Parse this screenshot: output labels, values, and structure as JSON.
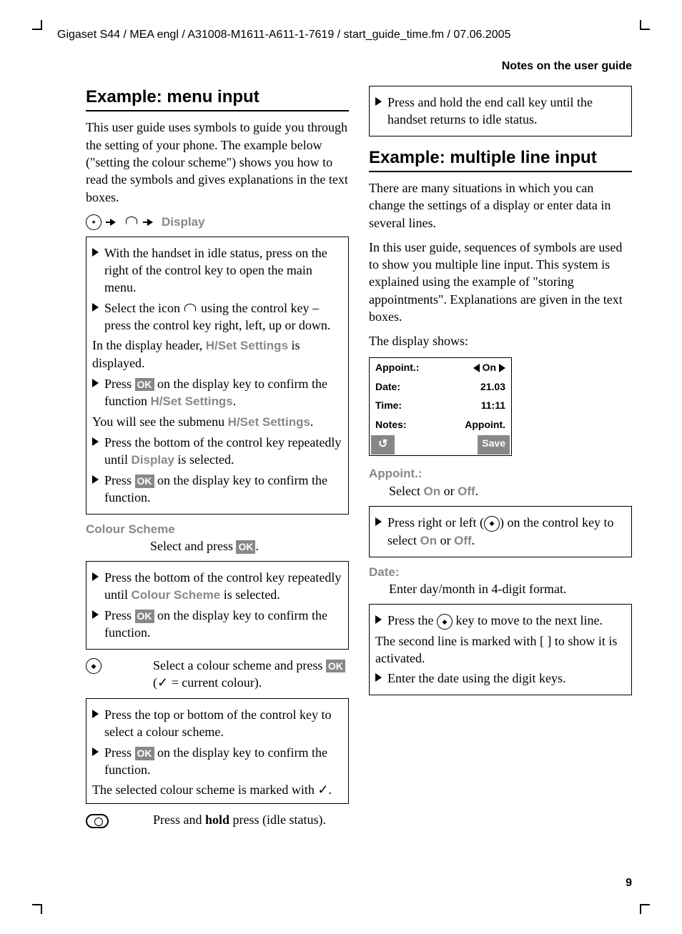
{
  "headerLine": "Gigaset S44 / MEA engl / A31008-M1611-A611-1-7619 / start_guide_time.fm / 07.06.2005",
  "notesHeader": "Notes on the user guide",
  "pageNum": "9",
  "h1": "Example: menu input",
  "intro1": "This user guide uses symbols to guide you through the setting of your phone. The example below (\"setting the colour scheme\") shows you how to read the symbols and gives explanations in the text boxes.",
  "displayLabel": "Display",
  "box1": {
    "b1": "With the handset in idle status, press on the right of the control key to open the main menu.",
    "b2a": "Select the icon ",
    "b2b": " using the control key – press the control key right, left, up or down.",
    "mid1a": "In the display header, ",
    "hset": "H/Set Settings",
    "mid1b": " is displayed.",
    "b3a": "Press ",
    "ok": "OK",
    "b3b": " on the display key to confirm the function ",
    "b3c": ".",
    "mid2a": "You will see the submenu ",
    "mid2b": ".",
    "b4a": "Press the bottom of the control key repeatedly until ",
    "displayWord": "Display",
    "b4b": " is selected.",
    "b5a": "Press ",
    "b5b": " on the display key to confirm the function."
  },
  "colourScheme": "Colour Scheme",
  "selectPress": "Select and press ",
  "box2": {
    "b1a": "Press the bottom of the control key repeatedly until ",
    "b1b": " is selected.",
    "b2a": "Press ",
    "b2b": " on the display key to confirm the function."
  },
  "def1a": "Select a colour scheme and press ",
  "def1b": " (",
  "def1c": " = current colour).",
  "box3": {
    "b1": "Press the top or bottom of the control key to select a colour scheme.",
    "b2a": "Press ",
    "b2b": " on the display key to confirm the function.",
    "tail": "The selected colour scheme is marked with "
  },
  "def2a": "Press and ",
  "hold": "hold",
  "def2b": " press (idle status).",
  "box4": "Press and hold the end call key until the handset returns to idle status.",
  "h2": "Example: multiple line input",
  "intro2": "There are many situations in which you can change the settings of a display or enter data in several lines.",
  "intro3": "In this user guide, sequences of symbols are used to show you multiple line input. This system is explained using the example of \"storing appointments\". Explanations are given in the text boxes.",
  "displayShows": "The display shows:",
  "screen": {
    "r1l": "Appoint.:",
    "r1r": "On",
    "r2l": "Date:",
    "r2r": "21.03",
    "r3l": "Time:",
    "r3r": "11:11",
    "r4l": "Notes:",
    "r4r": "Appoint.",
    "back": "↺",
    "save": "Save"
  },
  "appointLabel": "Appoint.:",
  "appointLine1a": "Select ",
  "on": "On",
  "or": " or ",
  "off": "Off",
  "box5a": "Press right or left (",
  "box5b": ") on the control key to select ",
  "dateLabel": "Date:",
  "dateLine": "Enter day/month in 4-digit format.",
  "box6": {
    "b1a": "Press the ",
    "b1b": " key to move to the next line.",
    "mid": "The second line is marked with [   ] to show it is activated.",
    "b2": "Enter the date using the digit keys."
  }
}
